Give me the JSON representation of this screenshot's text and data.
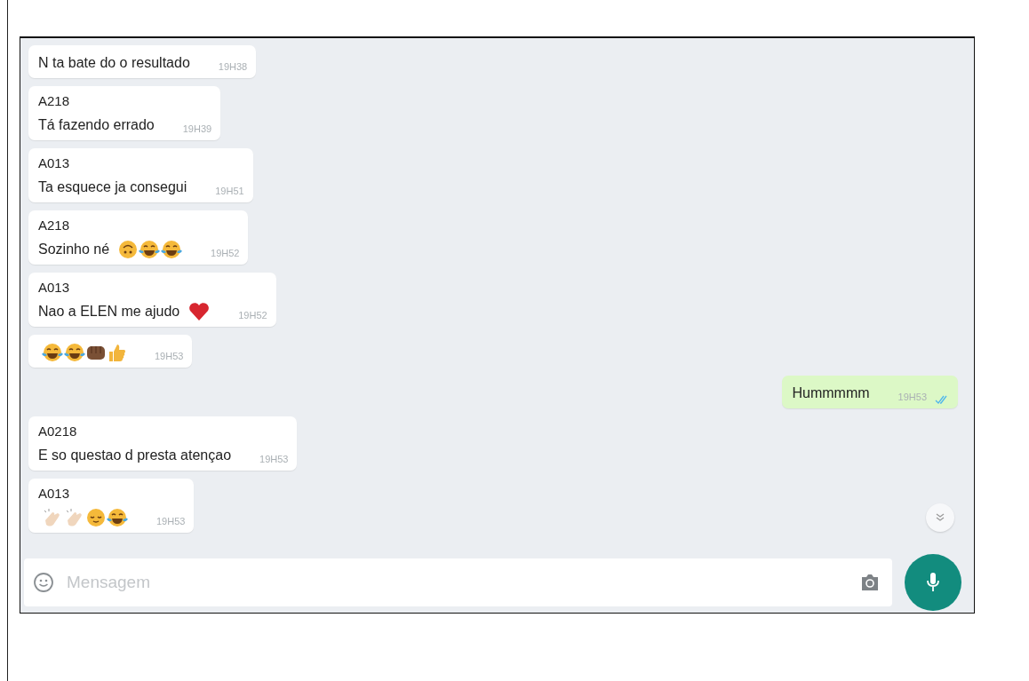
{
  "messages": [
    {
      "outgoing": false,
      "text": "N ta bate do o resultado",
      "time": "19H38"
    },
    {
      "outgoing": false,
      "sender": "A218",
      "text": "Tá fazendo errado",
      "time": "19H39"
    },
    {
      "outgoing": false,
      "sender": "A013",
      "text": "Ta esquece ja consegui",
      "time": "19H51"
    },
    {
      "outgoing": false,
      "sender": "A218",
      "text": "Sozinho né",
      "emojis": [
        {
          "kind": "upside"
        },
        {
          "kind": "joy"
        },
        {
          "kind": "joy"
        }
      ],
      "time": "19H52"
    },
    {
      "outgoing": false,
      "sender": "A013",
      "text": "Nao a ELEN me ajudo",
      "emojis": [
        {
          "kind": "heart"
        }
      ],
      "time": "19H52"
    },
    {
      "outgoing": false,
      "emojis": [
        {
          "kind": "joy"
        },
        {
          "kind": "joy"
        },
        {
          "kind": "fist"
        },
        {
          "kind": "thumb"
        }
      ],
      "time": "19H53"
    },
    {
      "outgoing": true,
      "text": "Hummmmm",
      "time": "19H53",
      "read": true
    },
    {
      "outgoing": false,
      "sender": "A0218",
      "text": "E so questao d presta atençao",
      "time": "19H53"
    },
    {
      "outgoing": false,
      "sender": "A013",
      "emojis": [
        {
          "kind": "clap"
        },
        {
          "kind": "clap"
        },
        {
          "kind": "relieved"
        },
        {
          "kind": "joy"
        }
      ],
      "time": "19H53"
    }
  ],
  "composer": {
    "placeholder": "Mensagem"
  }
}
